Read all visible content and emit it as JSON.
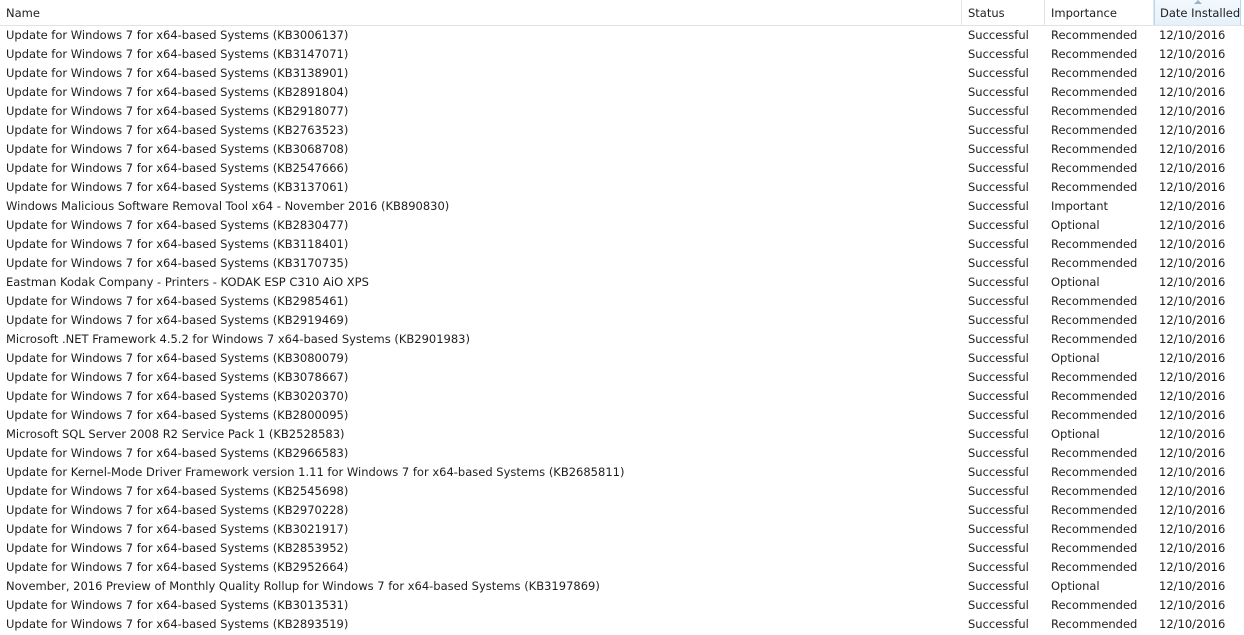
{
  "columns": {
    "name": "Name",
    "status": "Status",
    "importance": "Importance",
    "date_installed": "Date Installed"
  },
  "sort_column": "date_installed",
  "rows": [
    {
      "name": "Update for Windows 7 for x64-based Systems (KB3006137)",
      "status": "Successful",
      "importance": "Recommended",
      "date": "12/10/2016"
    },
    {
      "name": "Update for Windows 7 for x64-based Systems (KB3147071)",
      "status": "Successful",
      "importance": "Recommended",
      "date": "12/10/2016"
    },
    {
      "name": "Update for Windows 7 for x64-based Systems (KB3138901)",
      "status": "Successful",
      "importance": "Recommended",
      "date": "12/10/2016"
    },
    {
      "name": "Update for Windows 7 for x64-based Systems (KB2891804)",
      "status": "Successful",
      "importance": "Recommended",
      "date": "12/10/2016"
    },
    {
      "name": "Update for Windows 7 for x64-based Systems (KB2918077)",
      "status": "Successful",
      "importance": "Recommended",
      "date": "12/10/2016"
    },
    {
      "name": "Update for Windows 7 for x64-based Systems (KB2763523)",
      "status": "Successful",
      "importance": "Recommended",
      "date": "12/10/2016"
    },
    {
      "name": "Update for Windows 7 for x64-based Systems (KB3068708)",
      "status": "Successful",
      "importance": "Recommended",
      "date": "12/10/2016"
    },
    {
      "name": "Update for Windows 7 for x64-based Systems (KB2547666)",
      "status": "Successful",
      "importance": "Recommended",
      "date": "12/10/2016"
    },
    {
      "name": "Update for Windows 7 for x64-based Systems (KB3137061)",
      "status": "Successful",
      "importance": "Recommended",
      "date": "12/10/2016"
    },
    {
      "name": "Windows Malicious Software Removal Tool x64 - November 2016 (KB890830)",
      "status": "Successful",
      "importance": "Important",
      "date": "12/10/2016"
    },
    {
      "name": "Update for Windows 7 for x64-based Systems (KB2830477)",
      "status": "Successful",
      "importance": "Optional",
      "date": "12/10/2016"
    },
    {
      "name": "Update for Windows 7 for x64-based Systems (KB3118401)",
      "status": "Successful",
      "importance": "Recommended",
      "date": "12/10/2016"
    },
    {
      "name": "Update for Windows 7 for x64-based Systems (KB3170735)",
      "status": "Successful",
      "importance": "Recommended",
      "date": "12/10/2016"
    },
    {
      "name": "Eastman Kodak Company - Printers - KODAK ESP C310 AiO XPS",
      "status": "Successful",
      "importance": "Optional",
      "date": "12/10/2016"
    },
    {
      "name": "Update for Windows 7 for x64-based Systems (KB2985461)",
      "status": "Successful",
      "importance": "Recommended",
      "date": "12/10/2016"
    },
    {
      "name": "Update for Windows 7 for x64-based Systems (KB2919469)",
      "status": "Successful",
      "importance": "Recommended",
      "date": "12/10/2016"
    },
    {
      "name": "Microsoft .NET Framework 4.5.2 for Windows 7 x64-based Systems (KB2901983)",
      "status": "Successful",
      "importance": "Recommended",
      "date": "12/10/2016"
    },
    {
      "name": "Update for Windows 7 for x64-based Systems (KB3080079)",
      "status": "Successful",
      "importance": "Optional",
      "date": "12/10/2016"
    },
    {
      "name": "Update for Windows 7 for x64-based Systems (KB3078667)",
      "status": "Successful",
      "importance": "Recommended",
      "date": "12/10/2016"
    },
    {
      "name": "Update for Windows 7 for x64-based Systems (KB3020370)",
      "status": "Successful",
      "importance": "Recommended",
      "date": "12/10/2016"
    },
    {
      "name": "Update for Windows 7 for x64-based Systems (KB2800095)",
      "status": "Successful",
      "importance": "Recommended",
      "date": "12/10/2016"
    },
    {
      "name": "Microsoft SQL Server 2008 R2 Service Pack 1 (KB2528583)",
      "status": "Successful",
      "importance": "Optional",
      "date": "12/10/2016"
    },
    {
      "name": "Update for Windows 7 for x64-based Systems (KB2966583)",
      "status": "Successful",
      "importance": "Recommended",
      "date": "12/10/2016"
    },
    {
      "name": "Update for Kernel-Mode Driver Framework version 1.11 for Windows 7 for x64-based Systems (KB2685811)",
      "status": "Successful",
      "importance": "Recommended",
      "date": "12/10/2016"
    },
    {
      "name": "Update for Windows 7 for x64-based Systems (KB2545698)",
      "status": "Successful",
      "importance": "Recommended",
      "date": "12/10/2016"
    },
    {
      "name": "Update for Windows 7 for x64-based Systems (KB2970228)",
      "status": "Successful",
      "importance": "Recommended",
      "date": "12/10/2016"
    },
    {
      "name": "Update for Windows 7 for x64-based Systems (KB3021917)",
      "status": "Successful",
      "importance": "Recommended",
      "date": "12/10/2016"
    },
    {
      "name": "Update for Windows 7 for x64-based Systems (KB2853952)",
      "status": "Successful",
      "importance": "Recommended",
      "date": "12/10/2016"
    },
    {
      "name": "Update for Windows 7 for x64-based Systems (KB2952664)",
      "status": "Successful",
      "importance": "Recommended",
      "date": "12/10/2016"
    },
    {
      "name": "November, 2016 Preview of Monthly Quality Rollup for Windows 7 for x64-based Systems (KB3197869)",
      "status": "Successful",
      "importance": "Optional",
      "date": "12/10/2016"
    },
    {
      "name": "Update for Windows 7 for x64-based Systems (KB3013531)",
      "status": "Successful",
      "importance": "Recommended",
      "date": "12/10/2016"
    },
    {
      "name": "Update for Windows 7 for x64-based Systems (KB2893519)",
      "status": "Successful",
      "importance": "Recommended",
      "date": "12/10/2016"
    }
  ]
}
